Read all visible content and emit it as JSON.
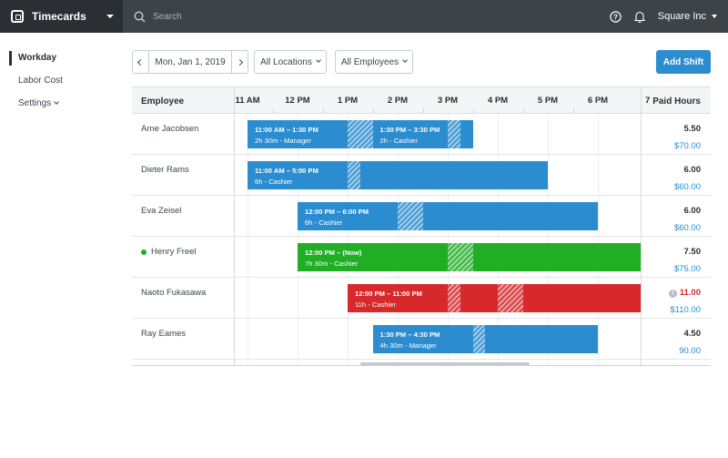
{
  "app": {
    "title": "Timecards",
    "search_placeholder": "Search",
    "account": "Square Inc"
  },
  "sidebar": {
    "items": [
      {
        "label": "Workday",
        "active": true
      },
      {
        "label": "Labor Cost",
        "active": false
      },
      {
        "label": "Settings",
        "active": false
      }
    ]
  },
  "toolbar": {
    "date": "Mon, Jan 1, 2019",
    "locations": "All Locations",
    "employees": "All Employees",
    "add_shift": "Add Shift"
  },
  "grid": {
    "employee_header": "Employee",
    "paid_header": "Paid Hours",
    "hours": [
      "11 AM",
      "12 PM",
      "1 PM",
      "2 PM",
      "3 PM",
      "4 PM",
      "5 PM",
      "6 PM",
      "7"
    ],
    "rows": [
      {
        "name": "Arne Jacobsen",
        "hours": "5.50",
        "pay": "$70.00",
        "shifts": [
          {
            "color": "blue",
            "time": "11:00 AM – 1:30 PM",
            "detail": "2h 30m - Manager",
            "start": 11.0,
            "end": 13.5,
            "breaks": [
              [
                13.0,
                13.5
              ]
            ]
          },
          {
            "color": "blue",
            "time": "1:30 PM – 3:30 PM",
            "detail": "2h - Cashier",
            "start": 13.5,
            "end": 15.5,
            "breaks": [
              [
                15.0,
                15.25
              ]
            ]
          }
        ]
      },
      {
        "name": "Dieter Rams",
        "hours": "6.00",
        "pay": "$60.00",
        "shifts": [
          {
            "color": "blue",
            "time": "11:00 AM – 5:00 PM",
            "detail": "6h - Cashier",
            "start": 11.0,
            "end": 17.0,
            "breaks": [
              [
                13.0,
                13.25
              ]
            ]
          }
        ]
      },
      {
        "name": "Eva Zeisel",
        "hours": "6.00",
        "pay": "$60.00",
        "shifts": [
          {
            "color": "blue",
            "time": "12:00 PM – 6:00 PM",
            "detail": "6h - Cashier",
            "start": 12.0,
            "end": 18.0,
            "breaks": [
              [
                14.0,
                14.5
              ]
            ]
          }
        ]
      },
      {
        "name": "Henry Freel",
        "active": true,
        "hours": "7.50",
        "pay": "$75.00",
        "shifts": [
          {
            "color": "green",
            "time": "12:00 PM – (Now)",
            "detail": "7h 30m - Cashier",
            "start": 12.0,
            "end": 19.0,
            "breaks": [
              [
                15.0,
                15.5
              ]
            ]
          }
        ]
      },
      {
        "name": "Naoto Fukasawa",
        "hours": "11.00",
        "hours_warning": true,
        "pay": "$110.00",
        "shifts": [
          {
            "color": "red",
            "time": "12:00 PM – 11:00 PM",
            "detail": "11h - Cashier",
            "start": 13.0,
            "end": 19.0,
            "breaks": [
              [
                15.0,
                15.25
              ],
              [
                16.0,
                16.5
              ]
            ]
          }
        ]
      },
      {
        "name": "Ray Eames",
        "hours": "4.50",
        "pay": "90.00",
        "shifts": [
          {
            "color": "blue",
            "time": "1:30 PM – 4:30 PM",
            "detail": "4h 30m - Manager",
            "start": 13.5,
            "end": 18.0,
            "breaks": [
              [
                15.5,
                15.75
              ]
            ]
          }
        ]
      }
    ]
  },
  "colors": {
    "topbar": "#3e4348",
    "brand": "#2b2f33",
    "accent": "#2b8ccf",
    "green": "#1fae24",
    "red": "#d7282b"
  },
  "icons": [
    "square-logo-icon",
    "search-icon",
    "help-icon",
    "bell-icon",
    "chevron-left-icon",
    "chevron-right-icon",
    "info-icon"
  ]
}
